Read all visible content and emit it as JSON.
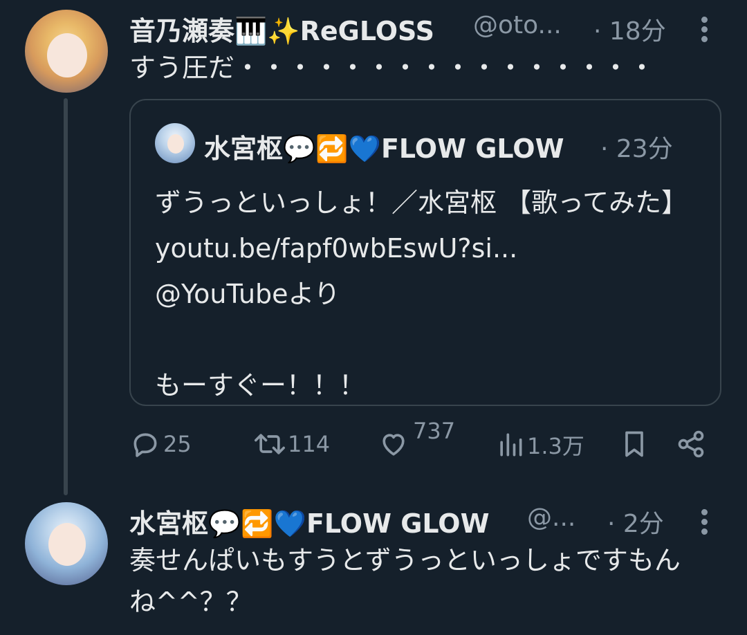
{
  "post1": {
    "name": "音乃瀬奏🎹✨ReGLOSS",
    "handle": "@oto...",
    "time": "· 18分",
    "text": "すう圧だ・・・・・・・・・・・・・・・・"
  },
  "quote": {
    "name": "水宮枢💬🔁💙FLOW GLOW",
    "time": "· 23分",
    "text": "ずうっといっしょ！／水宮枢 【歌ってみた】 youtu.be/fapf0wbEswU?si...\n@YouTubeより\n\nもーすぐー！！！"
  },
  "actions": {
    "replies": "25",
    "reposts": "114",
    "likes": "737",
    "views": "1.3万"
  },
  "post2": {
    "name": "水宮枢💬🔁💙FLOW GLOW",
    "handle": "@...",
    "time": "· 2分",
    "text": "奏せんぱいもすうとずうっといっしょですもんね^^？？"
  }
}
